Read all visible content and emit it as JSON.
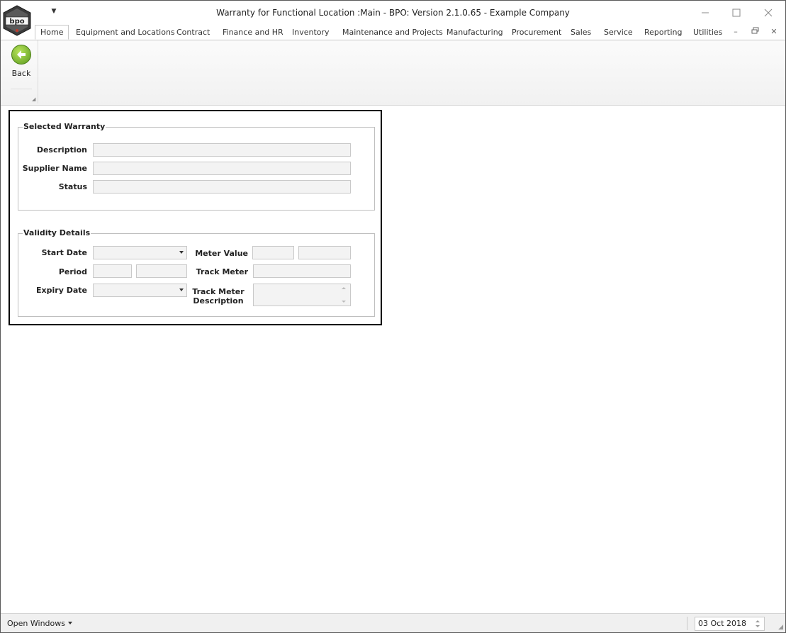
{
  "window": {
    "title": "Warranty for Functional Location :Main - BPO: Version 2.1.0.65 - Example Company"
  },
  "ribbon": {
    "tabs": [
      {
        "label": "Home"
      },
      {
        "label": "Equipment and Locations"
      },
      {
        "label": "Contract"
      },
      {
        "label": "Finance and HR"
      },
      {
        "label": "Inventory"
      },
      {
        "label": "Maintenance and Projects"
      },
      {
        "label": "Manufacturing"
      },
      {
        "label": "Procurement"
      },
      {
        "label": "Sales"
      },
      {
        "label": "Service"
      },
      {
        "label": "Reporting"
      },
      {
        "label": "Utilities"
      }
    ],
    "back_label": "Back"
  },
  "selected_warranty": {
    "title": "Selected Warranty",
    "description_label": "Description",
    "description_value": "",
    "supplier_label": "Supplier Name",
    "supplier_value": "",
    "status_label": "Status",
    "status_value": ""
  },
  "validity": {
    "title": "Validity Details",
    "start_date_label": "Start Date",
    "start_date_value": "",
    "period_label": "Period",
    "period_value": "",
    "period_unit": "",
    "expiry_label": "Expiry Date",
    "expiry_value": "",
    "meter_value_label": "Meter Value",
    "meter_value": "",
    "meter_unit": "",
    "track_meter_label": "Track Meter",
    "track_meter_value": "",
    "track_meter_desc_label_1": "Track Meter",
    "track_meter_desc_label_2": "Description",
    "track_meter_desc_value": ""
  },
  "statusbar": {
    "open_windows": "Open Windows",
    "date": "03 Oct 2018"
  }
}
